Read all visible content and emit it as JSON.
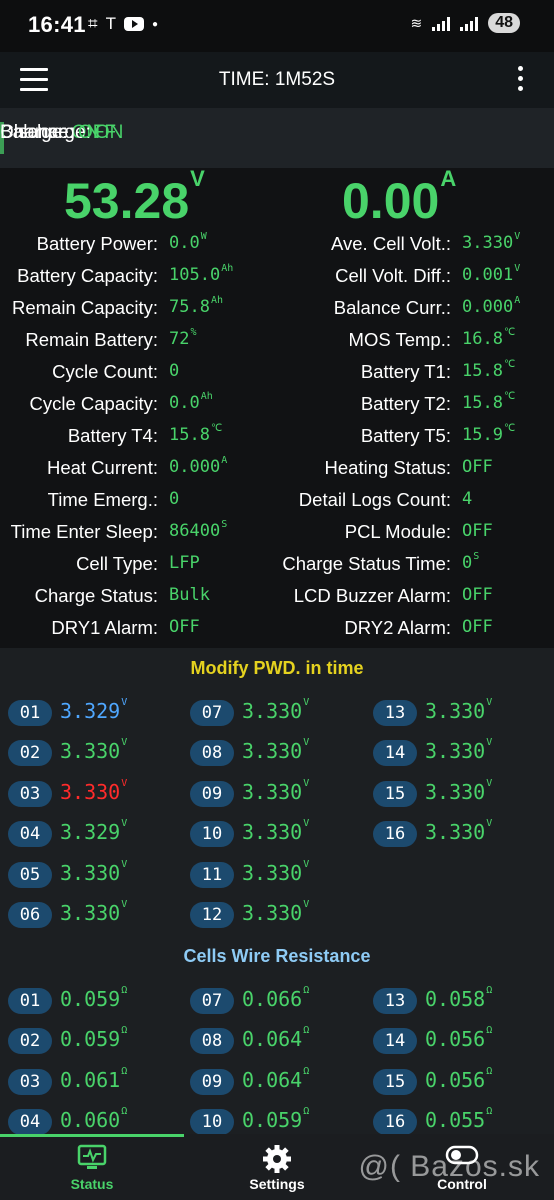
{
  "status_bar": {
    "time": "16:41",
    "battery": "48"
  },
  "header": {
    "title": "TIME: 1M52S"
  },
  "charge_row": [
    {
      "label": "Charge:",
      "value": "ON"
    },
    {
      "label": "Discharge:",
      "value": "ON"
    },
    {
      "label": "Balance:",
      "value": "OFF"
    }
  ],
  "big": {
    "voltage": "53.28",
    "voltage_unit": "V",
    "current": "0.00",
    "current_unit": "A"
  },
  "params": [
    [
      {
        "label": "Battery Power:",
        "value": "0.0",
        "unit": "W"
      },
      {
        "label": "Ave. Cell Volt.:",
        "value": "3.330",
        "unit": "V"
      }
    ],
    [
      {
        "label": "Battery Capacity:",
        "value": "105.0",
        "unit": "Ah"
      },
      {
        "label": "Cell Volt. Diff.:",
        "value": "0.001",
        "unit": "V"
      }
    ],
    [
      {
        "label": "Remain Capacity:",
        "value": "75.8",
        "unit": "Ah"
      },
      {
        "label": "Balance Curr.:",
        "value": "0.000",
        "unit": "A"
      }
    ],
    [
      {
        "label": "Remain Battery:",
        "value": "72",
        "unit": "%"
      },
      {
        "label": "MOS Temp.:",
        "value": "16.8",
        "unit": "℃"
      }
    ],
    [
      {
        "label": "Cycle Count:",
        "value": "0",
        "unit": ""
      },
      {
        "label": "Battery T1:",
        "value": "15.8",
        "unit": "℃"
      }
    ],
    [
      {
        "label": "Cycle Capacity:",
        "value": "0.0",
        "unit": "Ah"
      },
      {
        "label": "Battery T2:",
        "value": "15.8",
        "unit": "℃"
      }
    ],
    [
      {
        "label": "Battery T4:",
        "value": "15.8",
        "unit": "℃"
      },
      {
        "label": "Battery T5:",
        "value": "15.9",
        "unit": "℃"
      }
    ],
    [
      {
        "label": "Heat Current:",
        "value": "0.000",
        "unit": "A"
      },
      {
        "label": "Heating Status:",
        "value": "OFF",
        "unit": ""
      }
    ],
    [
      {
        "label": "Time Emerg.:",
        "value": "0",
        "unit": ""
      },
      {
        "label": "Detail Logs Count:",
        "value": "4",
        "unit": ""
      }
    ],
    [
      {
        "label": "Time Enter Sleep:",
        "value": "86400",
        "unit": "S"
      },
      {
        "label": "PCL Module:",
        "value": "OFF",
        "unit": ""
      }
    ],
    [
      {
        "label": "Cell Type:",
        "value": "LFP",
        "unit": ""
      },
      {
        "label": "Charge Status Time:",
        "value": "0",
        "unit": "S"
      }
    ],
    [
      {
        "label": "Charge Status:",
        "value": "Bulk",
        "unit": ""
      },
      {
        "label": "LCD Buzzer Alarm:",
        "value": "OFF",
        "unit": ""
      }
    ],
    [
      {
        "label": "DRY1 Alarm:",
        "value": "OFF",
        "unit": ""
      },
      {
        "label": "DRY2 Alarm:",
        "value": "OFF",
        "unit": ""
      }
    ]
  ],
  "cells_section": {
    "title": "Modify PWD. in time",
    "unit": "V",
    "cells": [
      {
        "id": "01",
        "value": "3.329",
        "color": "#4fa7ff"
      },
      {
        "id": "02",
        "value": "3.330",
        "color": "#49d36a"
      },
      {
        "id": "03",
        "value": "3.330",
        "color": "#ff2b2b"
      },
      {
        "id": "04",
        "value": "3.329",
        "color": "#49d36a"
      },
      {
        "id": "05",
        "value": "3.330",
        "color": "#49d36a"
      },
      {
        "id": "06",
        "value": "3.330",
        "color": "#49d36a"
      },
      {
        "id": "07",
        "value": "3.330",
        "color": "#49d36a"
      },
      {
        "id": "08",
        "value": "3.330",
        "color": "#49d36a"
      },
      {
        "id": "09",
        "value": "3.330",
        "color": "#49d36a"
      },
      {
        "id": "10",
        "value": "3.330",
        "color": "#49d36a"
      },
      {
        "id": "11",
        "value": "3.330",
        "color": "#49d36a"
      },
      {
        "id": "12",
        "value": "3.330",
        "color": "#49d36a"
      },
      {
        "id": "13",
        "value": "3.330",
        "color": "#49d36a"
      },
      {
        "id": "14",
        "value": "3.330",
        "color": "#49d36a"
      },
      {
        "id": "15",
        "value": "3.330",
        "color": "#49d36a"
      },
      {
        "id": "16",
        "value": "3.330",
        "color": "#49d36a"
      }
    ]
  },
  "resistance_section": {
    "title": "Cells Wire Resistance",
    "unit": "Ω",
    "cells": [
      {
        "id": "01",
        "value": "0.059"
      },
      {
        "id": "02",
        "value": "0.059"
      },
      {
        "id": "03",
        "value": "0.061"
      },
      {
        "id": "04",
        "value": "0.060"
      },
      {
        "id": "07",
        "value": "0.066"
      },
      {
        "id": "08",
        "value": "0.064"
      },
      {
        "id": "09",
        "value": "0.064"
      },
      {
        "id": "10",
        "value": "0.059"
      },
      {
        "id": "13",
        "value": "0.058"
      },
      {
        "id": "14",
        "value": "0.056"
      },
      {
        "id": "15",
        "value": "0.056"
      },
      {
        "id": "16",
        "value": "0.055"
      }
    ]
  },
  "bottom_nav": [
    {
      "label": "Status",
      "icon": "monitor-icon",
      "active": true
    },
    {
      "label": "Settings",
      "icon": "gear-icon",
      "active": false
    },
    {
      "label": "Control",
      "icon": "toggle-icon",
      "active": false
    }
  ],
  "watermark": "@( Bazos.sk",
  "colors": {
    "accent_green": "#49d36a",
    "section_title_yellow": "#e5d21f",
    "section_title_blue": "#8ecbf5",
    "badge_blue": "#1c4a6e"
  }
}
